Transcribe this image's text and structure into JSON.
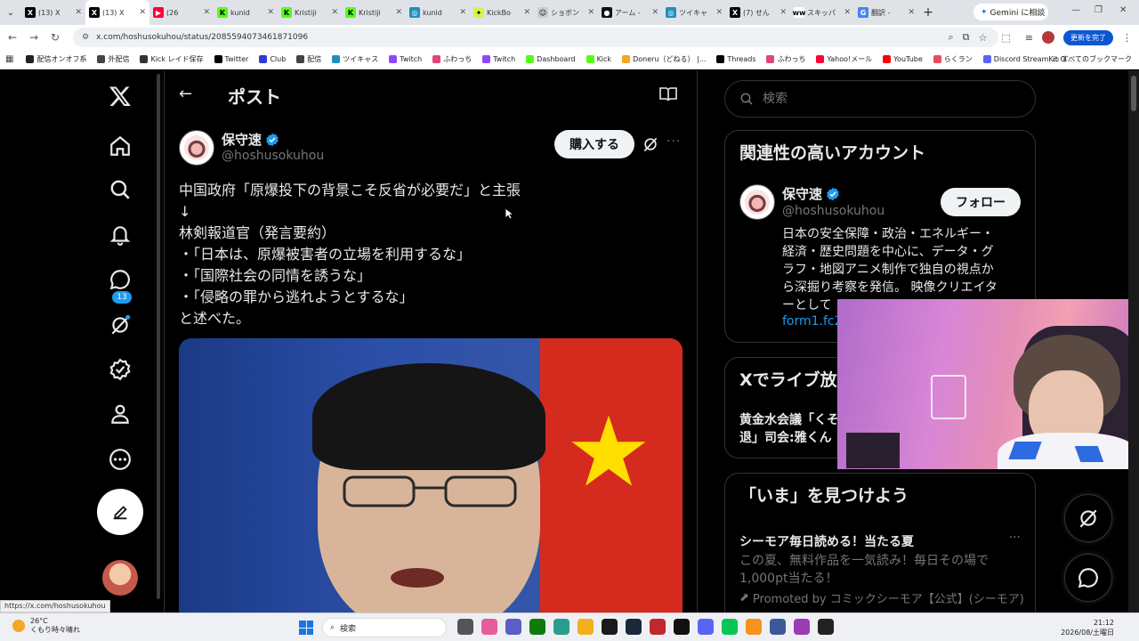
{
  "browser": {
    "tabs": [
      {
        "label": "(13) X",
        "fav_color": "#000000",
        "fav_text": "X",
        "active": false
      },
      {
        "label": "(13) X",
        "fav_color": "#000000",
        "fav_text": "X",
        "active": true
      },
      {
        "label": "(26",
        "fav_color": "#ff0033",
        "fav_text": "▶",
        "active": false
      },
      {
        "label": "kunid",
        "fav_color": "#53fc18",
        "fav_text": "K",
        "active": false
      },
      {
        "label": "Kristiji",
        "fav_color": "#53fc18",
        "fav_text": "K",
        "active": false
      },
      {
        "label": "Kristiji",
        "fav_color": "#53fc18",
        "fav_text": "K",
        "active": false
      },
      {
        "label": "kunid",
        "fav_color": "#1f8fbf",
        "fav_text": "◎",
        "active": false
      },
      {
        "label": "KickBo",
        "fav_color": "#d7f542",
        "fav_text": "✦",
        "active": false
      },
      {
        "label": "ショボン",
        "fav_color": "#cccccc",
        "fav_text": "☺",
        "active": false
      },
      {
        "label": "アーム -",
        "fav_color": "#111111",
        "fav_text": "●",
        "active": false
      },
      {
        "label": "ツイキャ",
        "fav_color": "#1f8fbf",
        "fav_text": "◎",
        "active": false
      },
      {
        "label": "(7) せん",
        "fav_color": "#000000",
        "fav_text": "X",
        "active": false
      },
      {
        "label": "スキッパ",
        "fav_color": "#ffffff",
        "fav_text": "ww",
        "active": false
      },
      {
        "label": "翻訳 -",
        "fav_color": "#4285f4",
        "fav_text": "G",
        "active": false
      }
    ],
    "new_tab": "+",
    "gemini_label": "Gemini に相談",
    "window_controls": [
      "—",
      "❐",
      "✕"
    ],
    "url": "x.com/hoshusokuhou/status/2085594073461871096",
    "update_label": "更新を完了",
    "bookmarks": [
      {
        "label": "配信オンオフ系",
        "color": "#222222"
      },
      {
        "label": "外配信",
        "color": "#444444"
      },
      {
        "label": "Kick レイド保存",
        "color": "#333333"
      },
      {
        "label": "Twitter",
        "color": "#000000"
      },
      {
        "label": "Club",
        "color": "#2e3bd8"
      },
      {
        "label": "配信",
        "color": "#444444"
      },
      {
        "label": "ツイキャス",
        "color": "#1f8fbf"
      },
      {
        "label": "Twitch",
        "color": "#9146ff"
      },
      {
        "label": "ふわっち",
        "color": "#e0457b"
      },
      {
        "label": "Twitch",
        "color": "#9146ff"
      },
      {
        "label": "Dashboard",
        "color": "#53fc18"
      },
      {
        "label": "Kick",
        "color": "#53fc18"
      },
      {
        "label": "Doneru（どねる） |...",
        "color": "#f5a623"
      },
      {
        "label": "Threads",
        "color": "#000000"
      },
      {
        "label": "ふわっち",
        "color": "#e0457b"
      },
      {
        "label": "Yahoo!メール",
        "color": "#ff0033"
      },
      {
        "label": "YouTube",
        "color": "#ff0000"
      },
      {
        "label": "らくラン",
        "color": "#e84a5f"
      },
      {
        "label": "Discord StreamKit O...",
        "color": "#5865f2"
      }
    ],
    "bookmarks_right": "すべてのブックマーク",
    "status_url": "https://x.com/hoshusokuhou"
  },
  "nav": {
    "notif_count": "13"
  },
  "main": {
    "title": "ポスト",
    "author_name": "保守速",
    "author_handle": "@hoshusokuhou",
    "buy_label": "購入する",
    "post_lines": [
      "中国政府「原爆投下の背景こそ反省が必要だ」と主張",
      "↓",
      "林剣報道官（発言要約）",
      "・「日本は、原爆被害者の立場を利用するな」",
      "・「国際社会の同情を誘うな」",
      "・「侵略の罪から逃れようとするな」",
      "と述べた。"
    ]
  },
  "sidebar": {
    "search_placeholder": "検索",
    "related": {
      "title": "関連性の高いアカウント",
      "name": "保守速",
      "handle": "@hoshusokuhou",
      "follow_label": "フォロー",
      "bio_lines": [
        "日本の安全保障・政治・エネルギー・",
        "経済・歴史問題を中心に、データ・グ",
        "ラフ・地図アニメ制作で独自の視点か",
        "ら深掘り考察を発信。 映像クリエイタ",
        "ーとして"
      ],
      "link": "form1.fc2"
    },
    "live": {
      "title": "Xでライブ放",
      "item_lines": [
        "黄金水会議「くそ",
        "退」司会:雅くん"
      ]
    },
    "trends": {
      "title": "「いま」を見つけよう",
      "category": "シーモア毎日読める！当たる夏",
      "more": "···",
      "desc_lines": [
        "この夏、無料作品を一気読み！毎日その場で",
        "1,000pt当たる！"
      ],
      "promo": "Promoted by コミックシーモア【公式】(シーモア)"
    }
  },
  "taskbar": {
    "temp": "26°C",
    "weather": "くもり時々晴れ",
    "search_placeholder": "検索",
    "time": "21:12",
    "date": "2026/08/土曜日",
    "icon_colors": [
      "#555555",
      "#e65c9c",
      "#5b5fc7",
      "#0f7b0f",
      "#2a9d8f",
      "#f2b01e",
      "#1a1a1a",
      "#1b2838",
      "#c1272d",
      "#111111",
      "#5865f2",
      "#06c755",
      "#f7931a",
      "#3b5998",
      "#9b3bb5",
      "#222222"
    ]
  }
}
